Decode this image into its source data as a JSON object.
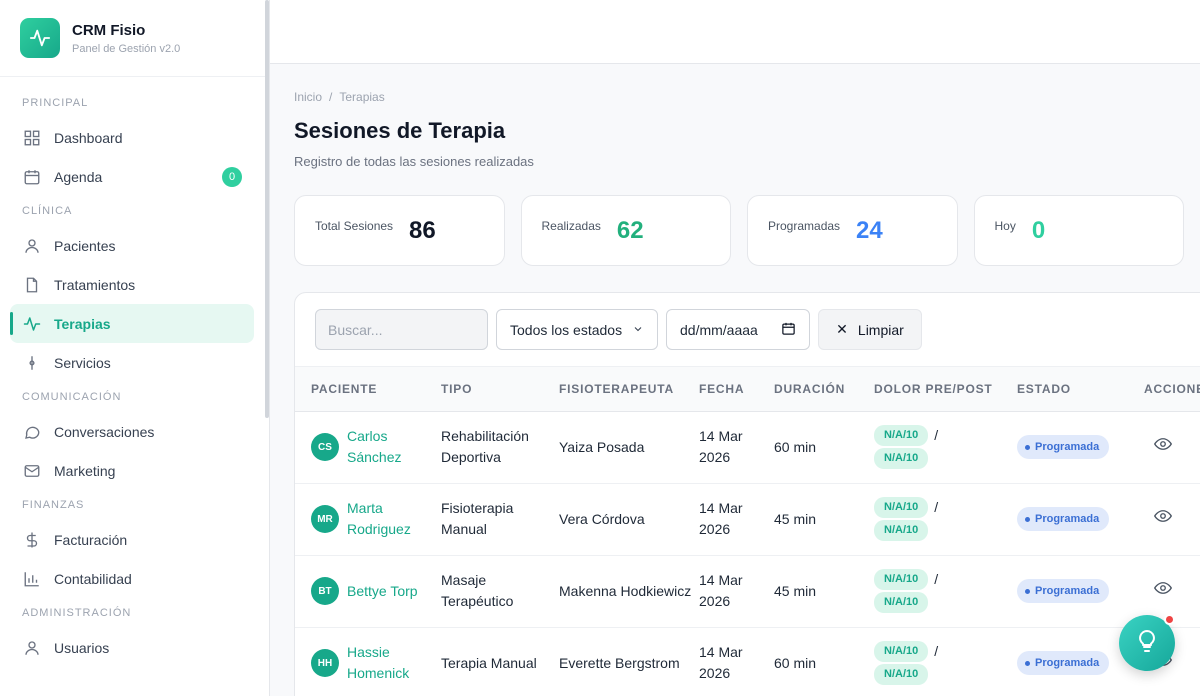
{
  "brand": {
    "title": "CRM Fisio",
    "subtitle": "Panel de Gestión v2.0"
  },
  "sidebar": {
    "sections": [
      {
        "title": "PRINCIPAL",
        "items": [
          {
            "label": "Dashboard",
            "icon": "grid-icon"
          },
          {
            "label": "Agenda",
            "icon": "calendar-icon",
            "badge": "0"
          }
        ]
      },
      {
        "title": "CLÍNICA",
        "items": [
          {
            "label": "Pacientes",
            "icon": "user-icon"
          },
          {
            "label": "Tratamientos",
            "icon": "document-icon"
          },
          {
            "label": "Terapias",
            "icon": "activity-icon",
            "active": true
          },
          {
            "label": "Servicios",
            "icon": "service-icon"
          }
        ]
      },
      {
        "title": "COMUNICACIÓN",
        "items": [
          {
            "label": "Conversaciones",
            "icon": "chat-icon"
          },
          {
            "label": "Marketing",
            "icon": "mail-icon"
          }
        ]
      },
      {
        "title": "FINANZAS",
        "items": [
          {
            "label": "Facturación",
            "icon": "dollar-icon"
          },
          {
            "label": "Contabilidad",
            "icon": "bar-chart-icon"
          }
        ]
      },
      {
        "title": "ADMINISTRACIÓN",
        "items": [
          {
            "label": "Usuarios",
            "icon": "user-icon"
          }
        ]
      }
    ]
  },
  "breadcrumb": {
    "home": "Inicio",
    "separator": "/",
    "current": "Terapias"
  },
  "page": {
    "title": "Sesiones de Terapia",
    "subtitle": "Registro de todas las sesiones realizadas"
  },
  "stats": [
    {
      "label": "Total Sesiones",
      "value": "86",
      "color": "#111827"
    },
    {
      "label": "Realizadas",
      "value": "62",
      "color": "#22b07d"
    },
    {
      "label": "Programadas",
      "value": "24",
      "color": "#3b82f6"
    },
    {
      "label": "Hoy",
      "value": "0",
      "color": "#2fcf9f"
    }
  ],
  "filters": {
    "search_placeholder": "Buscar...",
    "status_selected": "Todos los estados",
    "date_placeholder": "dd/mm/aaaa",
    "clear_label": "Limpiar"
  },
  "table": {
    "headers": [
      "PACIENTE",
      "TIPO",
      "FISIOTERAPEUTA",
      "FECHA",
      "DURACIÓN",
      "DOLOR PRE/POST",
      "ESTADO",
      "ACCIONES"
    ],
    "rows": [
      {
        "initials": "CS",
        "patient": "Carlos Sánchez",
        "type": "Rehabilitación Deportiva",
        "therapist": "Yaiza Posada",
        "date": "14 Mar 2026",
        "duration": "60 min",
        "pain_pre": "N/A/10",
        "pain_post": "N/A/10",
        "status": "Programada"
      },
      {
        "initials": "MR",
        "patient": "Marta Rodriguez",
        "type": "Fisioterapia Manual",
        "therapist": "Vera Córdova",
        "date": "14 Mar 2026",
        "duration": "45 min",
        "pain_pre": "N/A/10",
        "pain_post": "N/A/10",
        "status": "Programada"
      },
      {
        "initials": "BT",
        "patient": "Bettye Torp",
        "type": "Masaje Terapéutico",
        "therapist": "Makenna Hodkiewicz",
        "date": "14 Mar 2026",
        "duration": "45 min",
        "pain_pre": "N/A/10",
        "pain_post": "N/A/10",
        "status": "Programada"
      },
      {
        "initials": "HH",
        "patient": "Hassie Homenick",
        "type": "Terapia Manual",
        "therapist": "Everette Bergstrom",
        "date": "14 Mar 2026",
        "duration": "60 min",
        "pain_pre": "N/A/10",
        "pain_post": "N/A/10",
        "status": "Programada"
      }
    ]
  },
  "colors": {
    "accent": "#17a88a",
    "active_bg": "#e6f8f2",
    "status_blue": "#3b6fd4",
    "notification": "#ef4444"
  }
}
